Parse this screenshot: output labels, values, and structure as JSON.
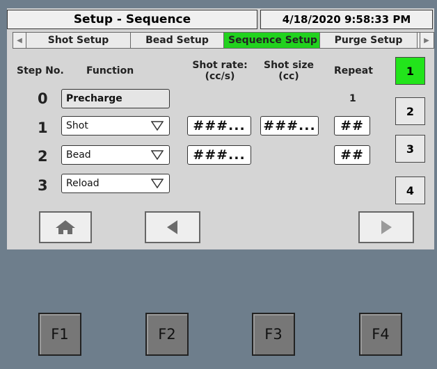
{
  "header": {
    "title": "Setup - Sequence",
    "datetime": "4/18/2020 9:58:33 PM"
  },
  "tabs": [
    {
      "label": "Shot Setup",
      "active": false
    },
    {
      "label": "Bead Setup",
      "active": false
    },
    {
      "label": "Sequence Setup",
      "active": true
    },
    {
      "label": "Purge Setup",
      "active": false
    }
  ],
  "columns": {
    "step_no": "Step No.",
    "function": "Function",
    "shot_rate": "Shot rate:",
    "shot_rate_unit": "(cc/s)",
    "shot_size": "Shot size",
    "shot_size_unit": "(cc)",
    "repeat": "Repeat"
  },
  "rows": [
    {
      "step": "0",
      "function": "Precharge",
      "repeat_text": "1"
    },
    {
      "step": "1",
      "function": "Shot",
      "shot_rate": "###...",
      "shot_size": "###...",
      "repeat": "##"
    },
    {
      "step": "2",
      "function": "Bead",
      "shot_rate": "###...",
      "repeat": "##"
    },
    {
      "step": "3",
      "function": "Reload"
    }
  ],
  "step_buttons": [
    "1",
    "2",
    "3",
    "4"
  ],
  "active_step": "1",
  "function_keys": [
    "F1",
    "F2",
    "F3",
    "F4"
  ],
  "icons": {
    "home": "home-icon",
    "prev": "arrow-left-icon",
    "next": "arrow-right-icon"
  },
  "colors": {
    "accent": "#22d21e",
    "background": "#6e7e8c"
  }
}
